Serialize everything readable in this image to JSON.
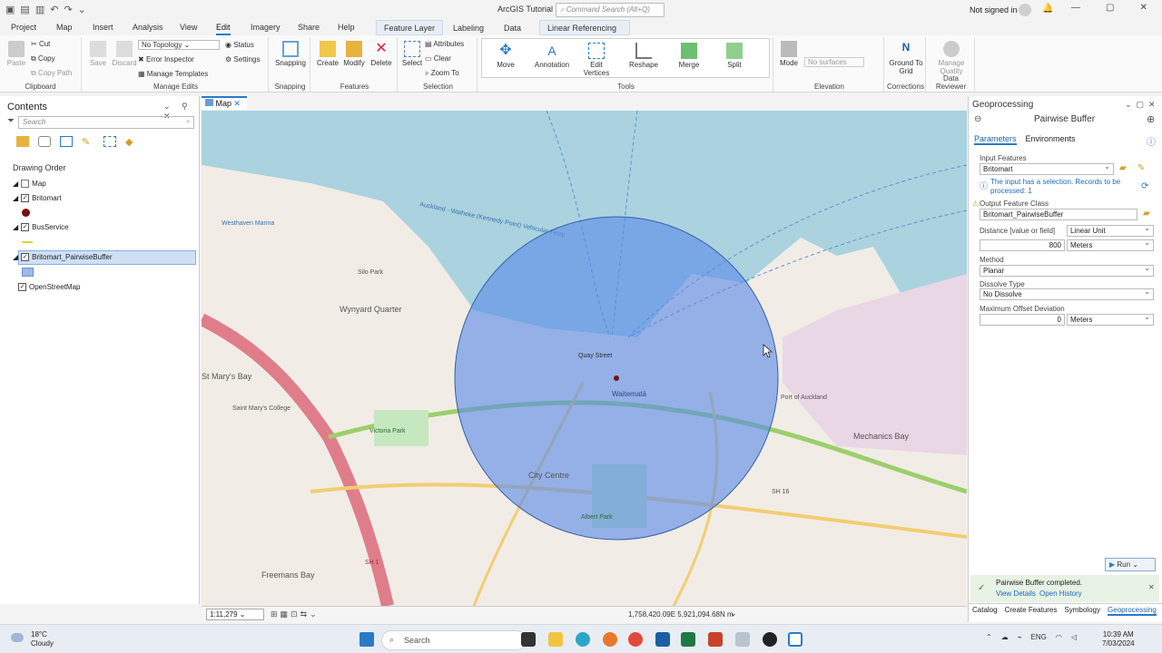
{
  "app": {
    "title": "ArcGIS Tutorial 2",
    "command_search_placeholder": "Command Search (Alt+Q)",
    "signin": "Not signed in"
  },
  "menu": {
    "tabs": [
      "Project",
      "Map",
      "Insert",
      "Analysis",
      "View",
      "Edit",
      "Imagery",
      "Share",
      "Help"
    ],
    "active": "Edit",
    "context_tabs": [
      "Feature Layer",
      "Labeling",
      "Data"
    ],
    "context_tabs2": [
      "Linear Referencing"
    ]
  },
  "ribbon": {
    "clipboard": {
      "label": "Clipboard",
      "paste": "Paste",
      "cut": "Cut",
      "copy": "Copy",
      "copy_path": "Copy Path"
    },
    "manage_edits": {
      "label": "Manage Edits",
      "save": "Save",
      "discard": "Discard",
      "topology": "No Topology",
      "status": "Status",
      "error_inspector": "Error Inspector",
      "settings": "Settings",
      "manage_templates": "Manage Templates"
    },
    "snapping": {
      "label": "Snapping",
      "btn": "Snapping"
    },
    "features": {
      "label": "Features",
      "create": "Create",
      "modify": "Modify",
      "delete": "Delete"
    },
    "selection": {
      "label": "Selection",
      "select": "Select",
      "attributes": "Attributes",
      "clear": "Clear",
      "zoom_to": "Zoom To"
    },
    "tools": {
      "label": "Tools",
      "items": [
        "Move",
        "Annotation",
        "Edit Vertices",
        "Reshape",
        "Merge",
        "Split"
      ]
    },
    "elevation": {
      "label": "Elevation",
      "mode": "Mode",
      "surface_placeholder": "No surfaces"
    },
    "corrections": {
      "label": "Corrections",
      "ground_to_grid": "Ground To Grid"
    },
    "data_reviewer": {
      "label": "Data Reviewer",
      "manage_quality": "Manage Quality"
    }
  },
  "contents": {
    "title": "Contents",
    "search_placeholder": "Search",
    "drawing_order": "Drawing Order",
    "layers": [
      {
        "name": "Map"
      },
      {
        "name": "Britomart",
        "checked": true,
        "symbol": "#7a1010"
      },
      {
        "name": "BusService",
        "checked": true,
        "symbol": "#d8d23a"
      },
      {
        "name": "Britomart_PairwiseBuffer",
        "checked": true,
        "symbol": "#9ab8e8",
        "selected": true
      },
      {
        "name": "OpenStreetMap",
        "checked": true
      }
    ]
  },
  "map": {
    "tab": "Map",
    "labels": [
      "Wynyard Quarter",
      "Mechanics Bay",
      "City Centre",
      "Waitematā",
      "Freemans Bay",
      "St Mary's Bay",
      "Port of Auckland",
      "Victoria Park",
      "Saint Mary's College",
      "Silo Park",
      "Westhaven Marina",
      "Albert Park",
      "SH 1",
      "SH 16",
      "Quay Street"
    ],
    "ferry_label": "Auckland - Waiheke (Kennedy Point) Vehicular Ferry",
    "scale": "1:11,279",
    "coordinates": "1,758,420.09E 5,921,094.68N m",
    "colors": {
      "water": "#aad3df",
      "land": "#f1ede6",
      "buffer": "#5b8ae6"
    }
  },
  "geoprocessing": {
    "panel_title": "Geoprocessing",
    "tool": "Pairwise Buffer",
    "tabs": [
      "Parameters",
      "Environments"
    ],
    "active_tab": "Parameters",
    "input_features_label": "Input Features",
    "input_features": "Britomart",
    "selection_note": "The input has a selection. Records to be processed: 1",
    "output_label": "Output Feature Class",
    "output": "Britomart_PairwiseBuffer",
    "distance_label": "Distance [value or field]",
    "distance_type": "Linear Unit",
    "distance": "800",
    "distance_unit": "Meters",
    "method_label": "Method",
    "method": "Planar",
    "dissolve_label": "Dissolve Type",
    "dissolve": "No Dissolve",
    "max_offset_label": "Maximum Offset Deviation",
    "max_offset": "0",
    "max_offset_unit": "Meters",
    "run": "Run",
    "message": "Pairwise Buffer completed.",
    "view_details": "View Details",
    "open_history": "Open History",
    "bottom_tabs": [
      "Catalog",
      "Create Features",
      "Symbology",
      "Geoprocessing"
    ],
    "active_bottom_tab": "Geoprocessing"
  },
  "taskbar": {
    "temp": "18°C",
    "condition": "Cloudy",
    "search": "Search",
    "lang": "ENG",
    "time": "10:39 AM",
    "date": "7/03/2024"
  }
}
